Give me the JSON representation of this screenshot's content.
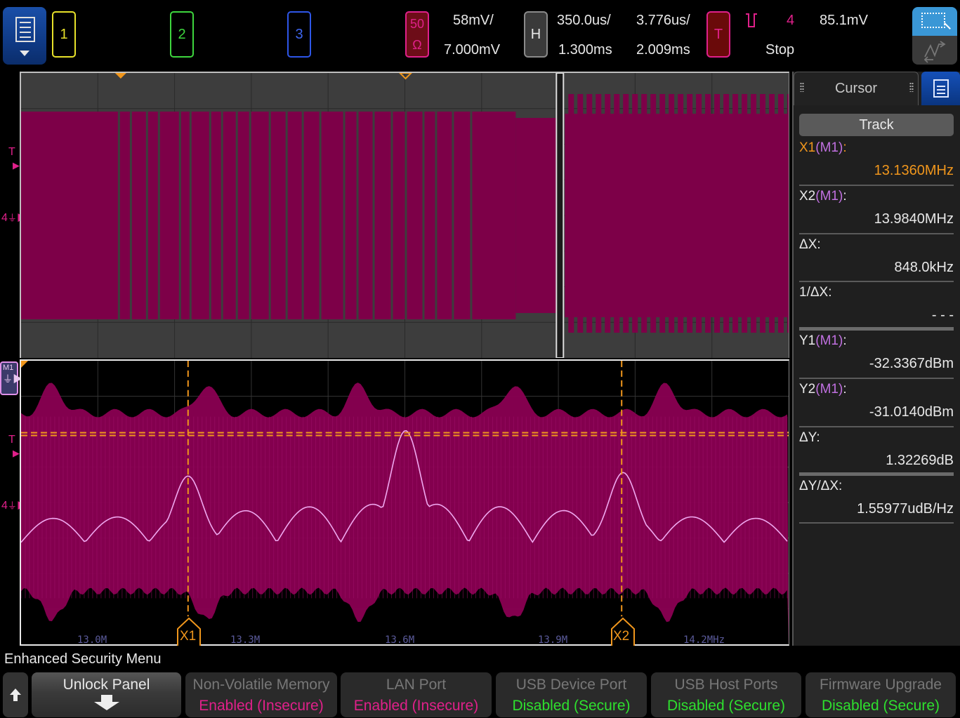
{
  "topbar": {
    "menu_icon": "document-menu-icon",
    "channels": [
      {
        "label": "1",
        "color": "#e8e22a"
      },
      {
        "label": "2",
        "color": "#3ed63e"
      },
      {
        "label": "3",
        "color": "#3f66f0"
      },
      {
        "label_top": "50",
        "label_bottom": "Ω",
        "color": "#e0208a"
      }
    ],
    "ch4_scale": "58mV/",
    "ch4_offset": "7.000mV",
    "horizontal_label": "H",
    "time_per_div": "350.0us/",
    "time_delay": "1.300ms",
    "zoom_time_per_div": "3.776us/",
    "zoom_delay": "2.009ms",
    "trigger_label": "T",
    "trigger_source": "4",
    "trigger_level": "85.1mV",
    "run_state": "Stop",
    "mode_buttons": [
      "zoom-select-icon",
      "waveform-measure-icon"
    ]
  },
  "upper_pane": {
    "markers": {
      "trigger": "T",
      "channel": "4"
    }
  },
  "lower_pane": {
    "math_label": "M1",
    "markers": {
      "trigger": "T",
      "channel": "4"
    },
    "x_ticks": [
      "13.0M",
      "13.3M",
      "13.6M",
      "13.9M",
      "14.2MHz"
    ],
    "cursor_x1_label": "X1",
    "cursor_x2_label": "X2"
  },
  "cursor_panel": {
    "tab_title": "Cursor",
    "track_button": "Track",
    "rows": [
      {
        "label": "X1",
        "source": "(M1)",
        "suffix": ":",
        "value": "13.1360MHz",
        "highlight": true
      },
      {
        "label": "X2",
        "source": "(M1)",
        "suffix": ":",
        "value": "13.9840MHz"
      },
      {
        "label": "ΔX:",
        "value": "848.0kHz"
      },
      {
        "label": "1/ΔX:",
        "value": "- - -"
      },
      {
        "label": "Y1",
        "source": "(M1)",
        "suffix": ":",
        "value": "-32.3367dBm"
      },
      {
        "label": "Y2",
        "source": "(M1)",
        "suffix": ":",
        "value": "-31.0140dBm"
      },
      {
        "label": "ΔY:",
        "value": "1.32269dB"
      },
      {
        "label": "ΔY/ΔX:",
        "value": "1.55977udB/Hz"
      }
    ]
  },
  "softkeys": {
    "menu_title": "Enhanced Security Menu",
    "back_icon": "up-arrow-icon",
    "unlock_panel": "Unlock Panel",
    "items": [
      {
        "label": "Non-Volatile Memory",
        "value": "Enabled (Insecure)",
        "status": "insecure"
      },
      {
        "label": "LAN Port",
        "value": "Enabled (Insecure)",
        "status": "insecure"
      },
      {
        "label": "USB Device Port",
        "value": "Disabled (Secure)",
        "status": "secure"
      },
      {
        "label": "USB Host Ports",
        "value": "Disabled (Secure)",
        "status": "secure"
      },
      {
        "label": "Firmware Upgrade",
        "value": "Disabled (Secure)",
        "status": "secure"
      }
    ]
  }
}
